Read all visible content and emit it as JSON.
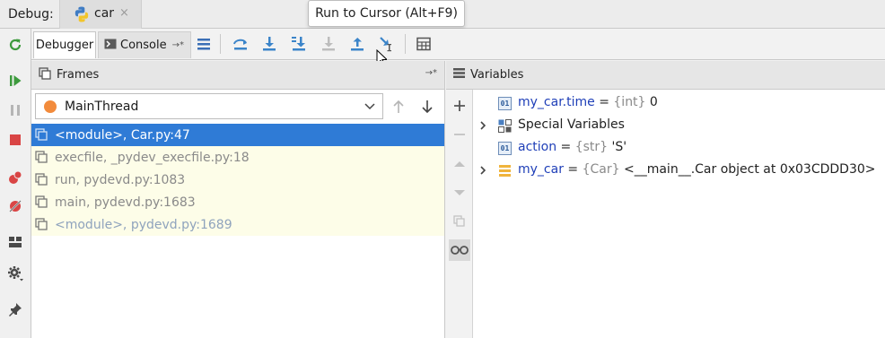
{
  "topbar": {
    "debug_label": "Debug:",
    "run_tab_label": "car",
    "close_glyph": "×"
  },
  "toolbar": {
    "debugger_tab": "Debugger",
    "console_tab": "Console",
    "console_pin": "→*"
  },
  "tooltip": {
    "text": "Run to Cursor (Alt+F9)"
  },
  "frames": {
    "title": "Frames",
    "pin": "→*",
    "thread": "MainThread",
    "rows": [
      {
        "text": "<module>, Car.py:47"
      },
      {
        "text": "execfile, _pydev_execfile.py:18"
      },
      {
        "text": "run, pydevd.py:1083"
      },
      {
        "text": "main, pydevd.py:1683"
      },
      {
        "text": "<module>, pydevd.py:1689"
      }
    ]
  },
  "variables": {
    "title": "Variables",
    "rows": [
      {
        "name": "my_car.time",
        "eq": " = ",
        "type": "{int} ",
        "value": "0",
        "icon": "01"
      },
      {
        "name": "Special Variables",
        "eq": "",
        "type": "",
        "value": "",
        "icon": "special"
      },
      {
        "name": "action",
        "eq": " = ",
        "type": "{str} ",
        "value": "'S'",
        "icon": "01"
      },
      {
        "name": "my_car",
        "eq": " = ",
        "type": "{Car} ",
        "value": "<__main__.Car object at 0x03CDDD30>",
        "icon": "object"
      }
    ]
  },
  "colors": {
    "selected_row": "#2f7bd6",
    "frame_bg": "#fdfde8",
    "var_name": "#1f3fb8",
    "thread_dot": "#f28b3c"
  }
}
